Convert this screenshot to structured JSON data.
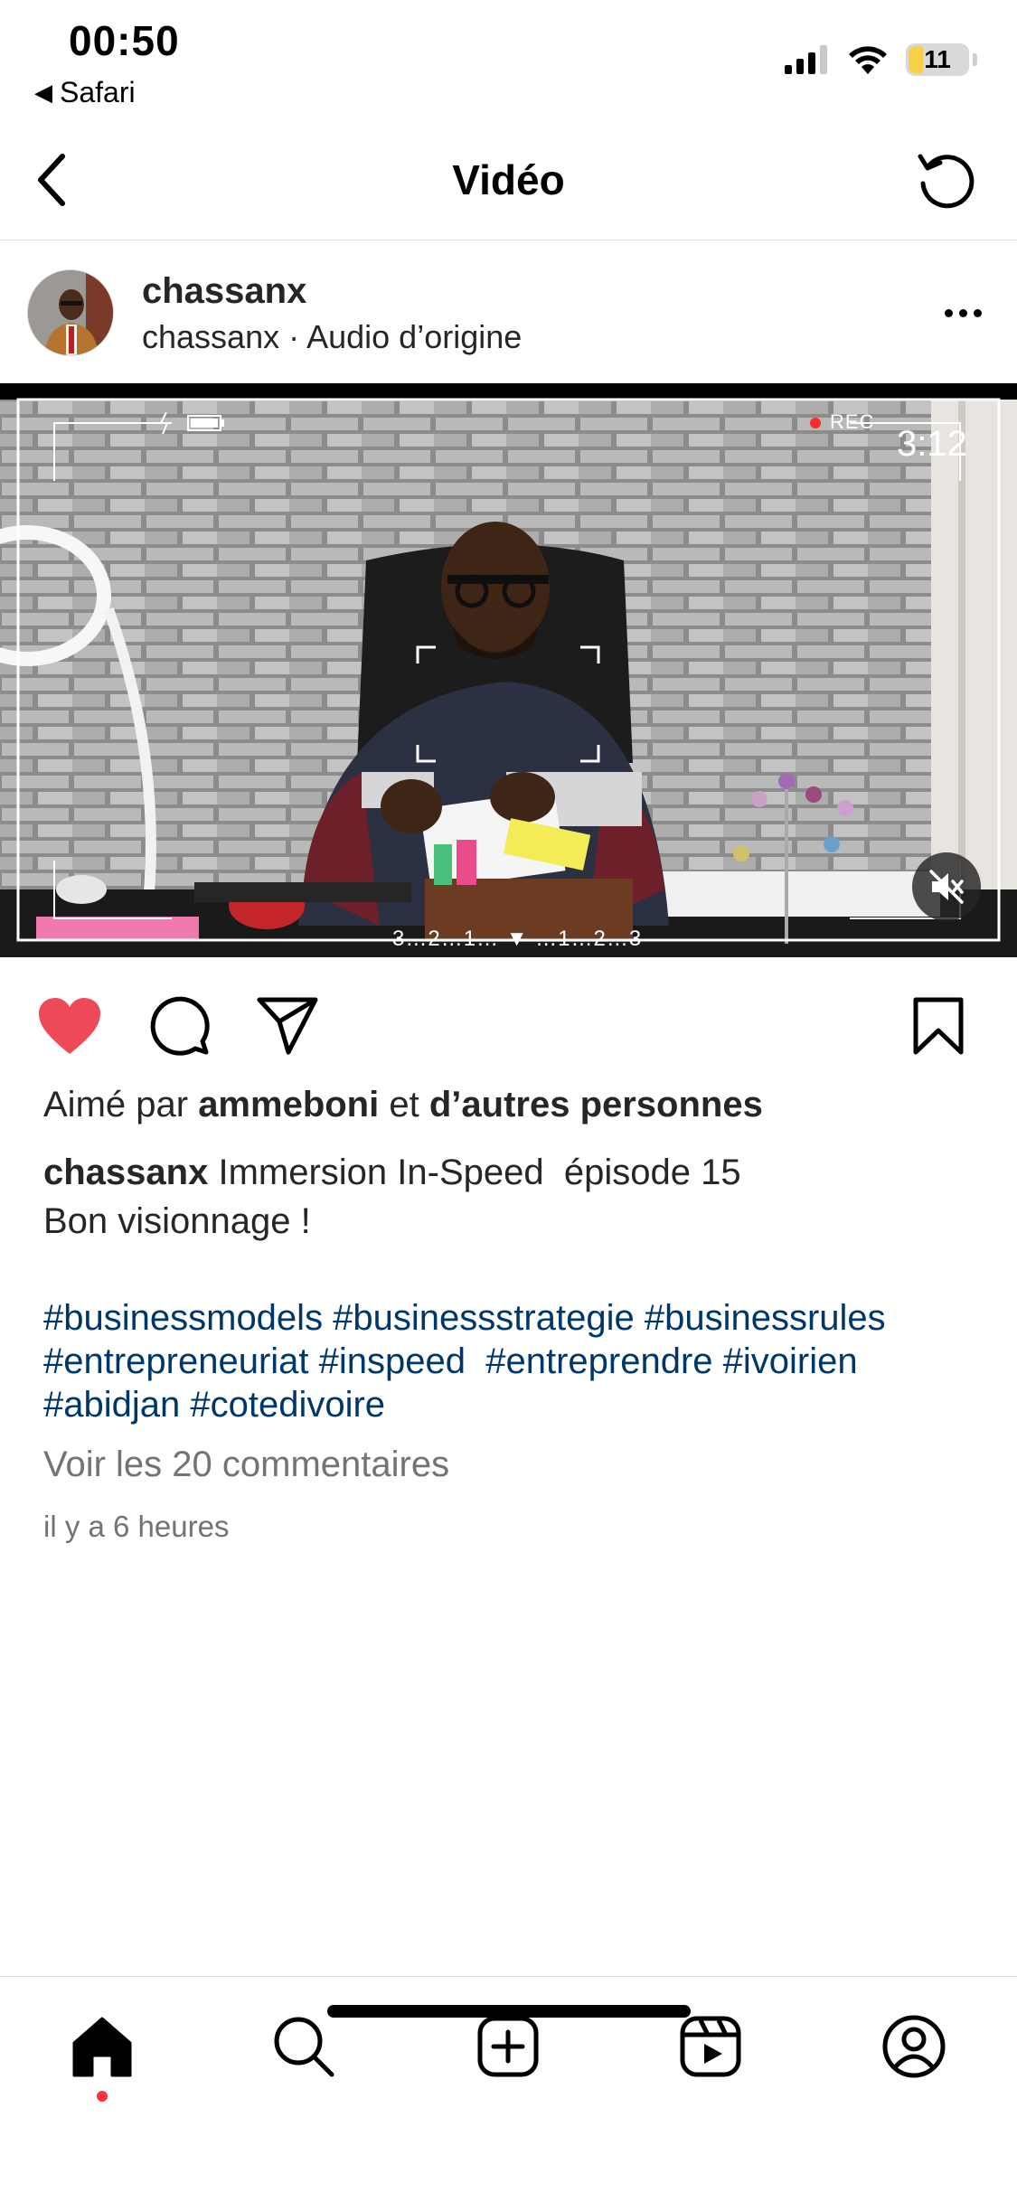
{
  "status_bar": {
    "time": "00:50",
    "back_app": "Safari",
    "battery": "11"
  },
  "nav": {
    "title": "Vidéo"
  },
  "post": {
    "username": "chassanx",
    "subline": "chassanx · Audio d’origine"
  },
  "video": {
    "rec_label": "REC",
    "rec_time": "3:12",
    "ruler": "3…2…1… ▼ …1…2…3"
  },
  "likes": {
    "prefix": "Aimé par",
    "user": "ammeboni",
    "connector": "et",
    "others": "d’autres personnes"
  },
  "caption": {
    "author": "chassanx",
    "line1": "Immersion In-Speed  épisode 15",
    "line2": "Bon visionnage !"
  },
  "hashtags": {
    "line1": "#businessmodels #businessstrategie #businessrules",
    "line2": "#entrepreneuriat #inspeed  #entreprendre #ivoirien",
    "line3": "#abidjan #cotedivoire"
  },
  "comments_link": "Voir les 20 commentaires",
  "timestamp": "il y a 6 heures",
  "colors": {
    "like_red": "#ed4956",
    "hashtag_blue": "#00376b",
    "muted_gray": "#737373",
    "notification_dot": "#ff3040"
  },
  "icons": {
    "nav_back": "chevron-left-icon",
    "nav_refresh": "refresh-icon",
    "like": "heart-filled-icon",
    "comment": "comment-icon",
    "share": "paper-plane-icon",
    "save": "bookmark-icon",
    "mute": "speaker-muted-icon",
    "tabs": [
      "home-icon",
      "search-icon",
      "create-icon",
      "reels-icon",
      "profile-icon"
    ]
  }
}
